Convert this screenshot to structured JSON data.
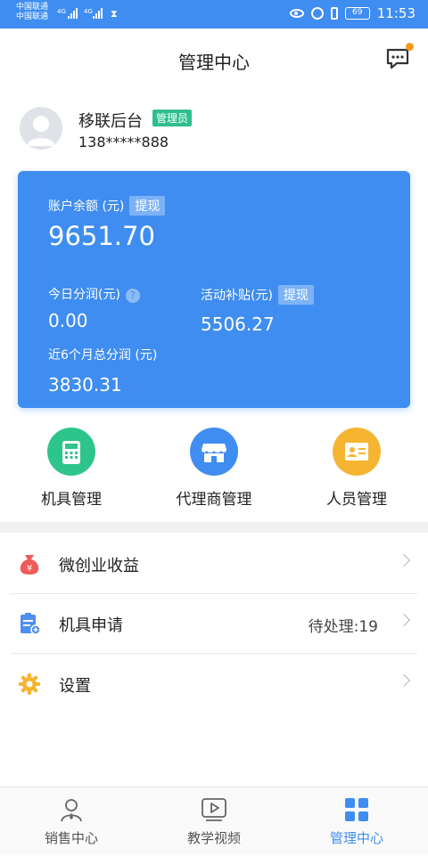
{
  "status_bar": {
    "carrier_1": "中国联通",
    "carrier_2": "中国联通",
    "network_1": "4G",
    "network_2": "4G",
    "battery": "69",
    "time": "11:53"
  },
  "header": {
    "title": "管理中心",
    "message_icon": "chat-bubble-icon"
  },
  "profile": {
    "name": "移联后台",
    "badge": "管理员",
    "phone": "138*****888"
  },
  "account_card": {
    "balance_label": "账户余额 (元)",
    "balance_withdraw": "提现",
    "balance_value": "9651.70",
    "today_profit_label": "今日分润(元)",
    "today_profit_help": "?",
    "today_profit_value": "0.00",
    "subsidy_label": "活动补贴(元)",
    "subsidy_withdraw": "提现",
    "subsidy_value": "5506.27",
    "six_month_label": "近6个月总分润 (元)",
    "six_month_value": "3830.31",
    "color": "#3f8df0"
  },
  "shortcuts": [
    {
      "label": "机具管理",
      "icon": "pos-machine-icon",
      "color": "#2ec58c"
    },
    {
      "label": "代理商管理",
      "icon": "store-icon",
      "color": "#3f8df0"
    },
    {
      "label": "人员管理",
      "icon": "id-card-icon",
      "color": "#f5b531"
    }
  ],
  "menu": [
    {
      "label": "微创业收益",
      "icon": "money-bag-icon",
      "extra": ""
    },
    {
      "label": "机具申请",
      "icon": "clipboard-add-icon",
      "extra": "待处理:19"
    },
    {
      "label": "设置",
      "icon": "gear-icon",
      "extra": ""
    }
  ],
  "bottom_nav": [
    {
      "label": "销售中心",
      "icon": "person-icon",
      "active": false
    },
    {
      "label": "教学视频",
      "icon": "video-play-icon",
      "active": false
    },
    {
      "label": "管理中心",
      "icon": "grid-icon",
      "active": true
    }
  ]
}
